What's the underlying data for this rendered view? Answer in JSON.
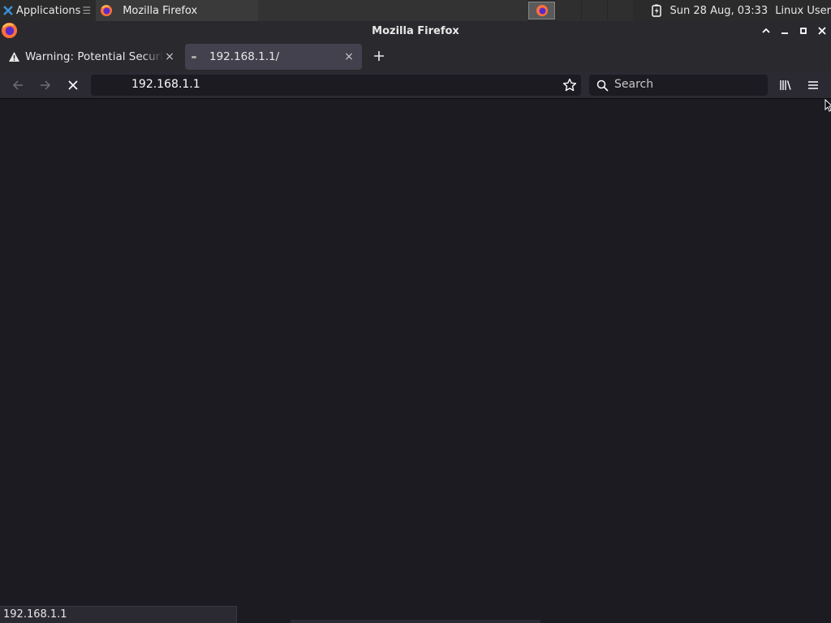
{
  "taskbar": {
    "applications_label": "Applications",
    "window_button_label": "Mozilla Firefox",
    "clock": "Sun 28 Aug, 03:33",
    "user": "Linux User"
  },
  "window": {
    "title": "Mozilla Firefox"
  },
  "tabs": [
    {
      "label": "Warning: Potential Security Risk Ahead",
      "icon": "warning-icon",
      "active": false
    },
    {
      "label": "192.168.1.1/",
      "icon": "loading-dot-icon",
      "active": true
    }
  ],
  "navbar": {
    "url": "192.168.1.1",
    "search_placeholder": "Search"
  },
  "status": {
    "text": "192.168.1.1"
  },
  "colors": {
    "content_bg": "#1c1b22",
    "toolbar_bg": "#2b2a33",
    "active_tab_bg": "#42414d"
  }
}
